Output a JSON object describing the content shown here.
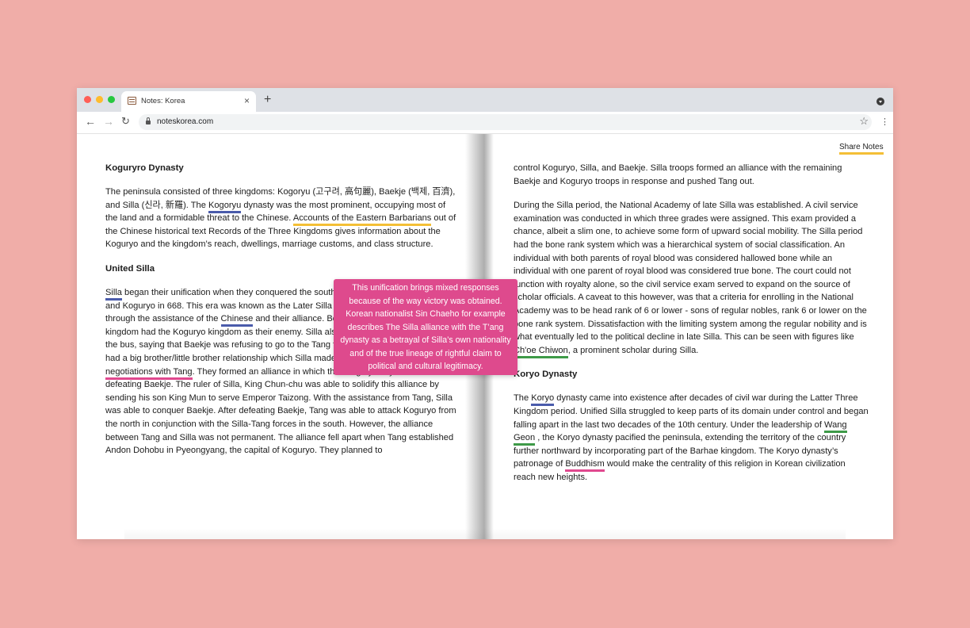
{
  "browser": {
    "tab_title": "Notes: Korea",
    "tab_close": "×",
    "new_tab": "+",
    "url": "noteskorea.com",
    "back_glyph": "←",
    "forward_glyph": "→",
    "reload_glyph": "↻",
    "star_glyph": "☆",
    "menu_glyph": "⋮"
  },
  "header": {
    "share_label": "Share Notes"
  },
  "colors": {
    "background": "#f0ada8",
    "highlight_blue": "#4a5bab",
    "highlight_yellow": "#f4bf36",
    "highlight_pink": "#e0488f",
    "highlight_green": "#3e9a48",
    "tooltip": "#de4a8d"
  },
  "icons": [
    "notebook-icon",
    "close-icon",
    "plus-icon",
    "back-arrow-icon",
    "forward-arrow-icon",
    "reload-icon",
    "lock-icon",
    "star-icon",
    "kebab-menu-icon",
    "chevron-down-icon"
  ],
  "left": {
    "h1": "Koguryro Dynasty",
    "p1": {
      "t1": "The peninsula consisted of three kingdoms: Kogoryu (고구려, 高句麗), Baekje (백제, 百濟), and Silla (신라, 新羅). The ",
      "h_kogoryu": "Kogoryu",
      "t2": " dynasty was the most prominent, occupying most of the land and a formidable threat to the Chinese. ",
      "h_accounts": "Accounts of the Eastern Barbarians",
      "t3": " out of the Chinese historical text Records of the Three Kingdoms gives information about the Koguryo and the kingdom’s reach, dwellings, marriage customs, and class structure."
    },
    "h2": "United Silla",
    "p2": {
      "h_silla": "Silla",
      "t1": " began their unification when they conquered the southern kingdom of Baekje in 660 and Koguryo in 668. This era was known as the Later Silla period. This was only possible through the assistance of the ",
      "h_chinese": "Chinese",
      "t2": " and their alliance. Both the Tang dynasty and Silla kingdom had the Koguryo kingdom as their enemy. Silla also threw Baekje kingdom under the bus, saying that Baekje was refusing to go to the Tang for tribute. China and Korea had a big brother/little brother relationship which Silla made sure to emphasize in their ",
      "h_negotiations": "negotiations with Tang",
      "t3": ". They formed an alliance in which the Tang dynasty assisted Silla in defeating Baekje. The ruler of Silla, King Chun-chu was able to solidify this alliance by sending his son King Mun to serve Emperor Taizong. With the assistance from Tang, Silla was able to conquer Baekje. After defeating Baekje, Tang was able to attack Koguryo from the north in conjunction with the Silla-Tang forces in the south. However, the alliance between Tang and Silla was not permanent. The alliance fell apart when Tang established Andon Dohobu in Pyeongyang, the capital of Koguryo. They planned to"
    }
  },
  "tooltip": {
    "text": "This unification brings mixed responses because of the way victory was obtained. Korean nationalist Sin Chaeho for example describes The Silla alliance with the T’ang dynasty as a betrayal of Silla’s own nationality and of the true lineage of rightful claim to political and cultural legitimacy."
  },
  "right": {
    "p0": "control Koguryo, Silla, and Baekje. Silla troops formed an alliance with the remaining Baekje and Koguryo troops in response and pushed Tang out.",
    "p1": {
      "t1": "During the Silla period, the National Academy of late Silla was established. A civil service examination was conducted in which three grades were assigned. This exam provided a chance, albeit a slim one, to achieve some form of upward social mobility. The Silla period had the bone rank system which was a hierarchical system of social classification. An individual with both parents of royal blood was considered hallowed bone while an individual with one parent of royal blood was considered true bone. The court could not function with royalty alone, so the civil service exam served to expand on the source of scholar officials. A caveat to this however, was that a criteria for enrolling in the National Academy was to be head rank of 6 or lower - sons of regular nobles, rank 6 or lower on the bone rank system. Dissatisfaction with the limiting system among the regular nobility and is what eventually led to the political decline in late Silla. This can be seen with figures like ",
      "h_choe": "Ch'oe Chiwon",
      "t2": ", a prominent scholar during Silla."
    },
    "h1": "Koryo Dynasty",
    "p2": {
      "t1": "The ",
      "h_koryo": "Koryo",
      "t2": " dynasty came into existence after decades of civil war during the Latter Three Kingdom period. Unified Silla struggled to keep parts of its domain under control and began falling apart in the last two decades of the 10th century. Under the leadership of ",
      "h_wang": "Wang Geon",
      "t3": " , the Koryo dynasty pacified the peninsula, extending the territory of the country further northward by incorporating part of the Barhae kingdom. The Koryo dynasty’s patronage of ",
      "h_buddhism": "Buddhism",
      "t4": " would make the centrality of this religion in Korean civilization reach new heights."
    }
  }
}
